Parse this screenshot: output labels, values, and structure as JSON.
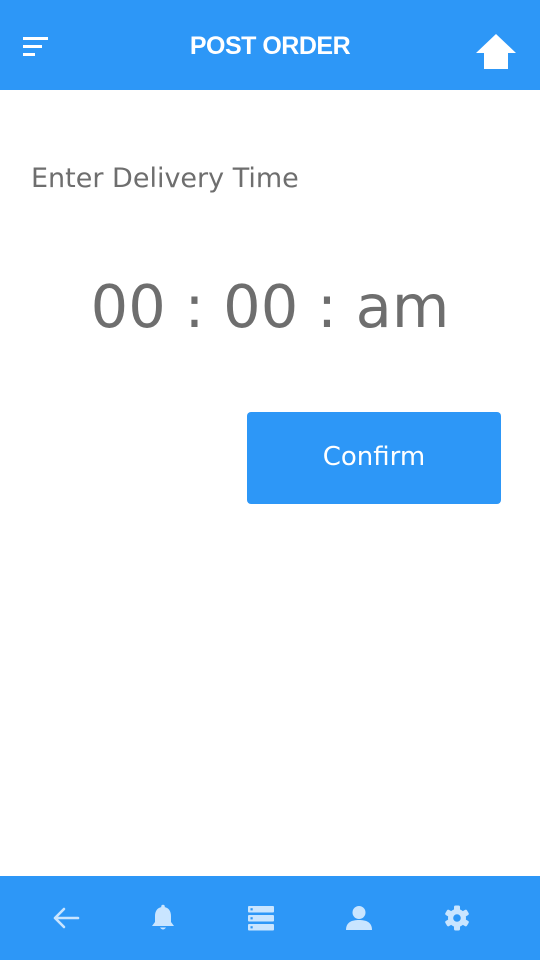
{
  "header": {
    "title": "POST ORDER",
    "menu_icon": "menu-icon",
    "home_icon": "home-icon"
  },
  "main": {
    "label": "Enter Delivery Time",
    "time": {
      "hours": "00",
      "separator1": ":",
      "minutes": "00",
      "separator2": ":",
      "period": "am"
    },
    "confirm_label": "Confirm"
  },
  "bottom_nav": {
    "items": [
      {
        "icon": "back-arrow-icon"
      },
      {
        "icon": "bell-icon"
      },
      {
        "icon": "orders-list-icon"
      },
      {
        "icon": "user-icon"
      },
      {
        "icon": "gear-icon"
      }
    ]
  },
  "colors": {
    "primary": "#2d97f7",
    "text_gray": "#6e6e6e",
    "nav_icon": "#c9e5ff",
    "white": "#ffffff"
  }
}
